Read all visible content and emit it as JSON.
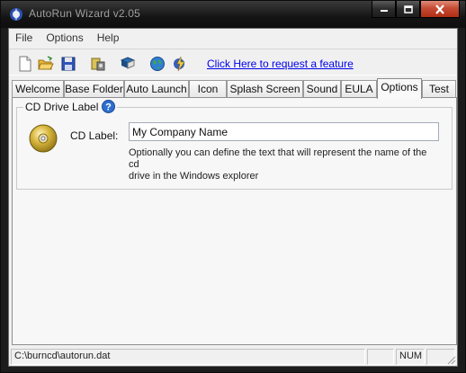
{
  "window": {
    "title": "AutoRun Wizard v2.05",
    "icon": "autorun-app-icon",
    "caption_buttons": [
      "minimize-icon",
      "maximize-icon",
      "close-icon"
    ]
  },
  "menu": [
    "File",
    "Options",
    "Help"
  ],
  "toolbar": {
    "buttons": [
      "new-icon",
      "open-folder-icon",
      "save-icon",
      "build-icon",
      "book-icon",
      "globe-icon",
      "lightning-icon"
    ],
    "feature_link": "Click Here to request a feature"
  },
  "tabs": [
    "Welcome",
    "Base Folder",
    "Auto Launch",
    "Icon",
    "Splash Screen",
    "Sound",
    "EULA",
    "Options",
    "Test"
  ],
  "active_tab": "Options",
  "cd_drive_group": {
    "legend": "CD Drive Label",
    "field_label": "CD Label:",
    "value": "My Company Name",
    "help_line1": "Optionally you can define the text that will represent the name of the cd",
    "help_line2": "drive in the Windows explorer"
  },
  "statusbar": {
    "path": "C:\\burncd\\autorun.dat",
    "num": "NUM"
  }
}
